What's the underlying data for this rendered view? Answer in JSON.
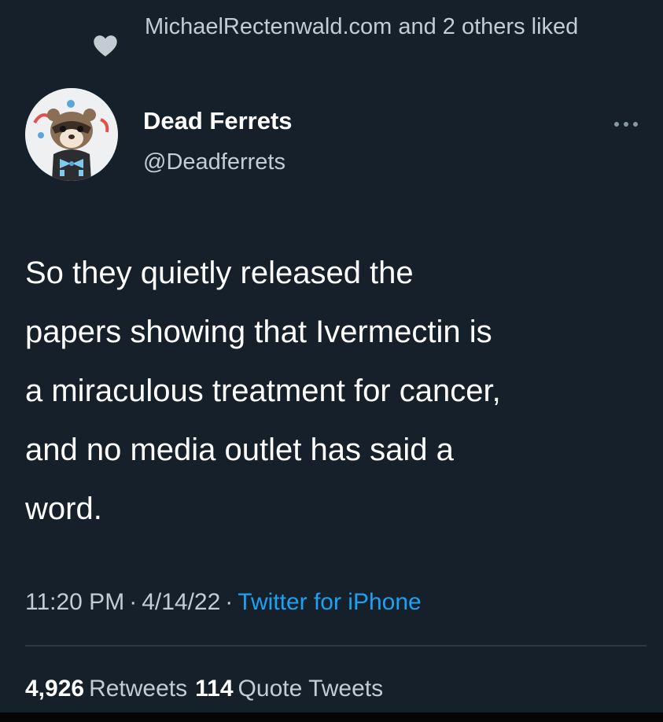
{
  "social_context": {
    "text": "MichaelRectenwald.com and 2 others liked",
    "icon": "heart-icon"
  },
  "author": {
    "name": "Dead Ferrets",
    "handle": "@Deadferrets",
    "avatar_icon": "ferret-avatar-icon"
  },
  "more_icon": "more-options-icon",
  "tweet": {
    "text": "So they quietly released the\npapers showing that Ivermectin is\na miraculous treatment for cancer,\nand no media outlet has said a\nword."
  },
  "meta": {
    "time": "11:20 PM",
    "separator": "·",
    "date": "4/14/22",
    "source": "Twitter for iPhone"
  },
  "stats": {
    "retweets_count": "4,926",
    "retweets_label": "Retweets",
    "quotes_count": "114",
    "quotes_label": "Quote Tweets"
  },
  "colors": {
    "background": "#15202b",
    "text_primary": "#ffffff",
    "text_secondary": "#c4ccd3",
    "link": "#1da1f2"
  }
}
